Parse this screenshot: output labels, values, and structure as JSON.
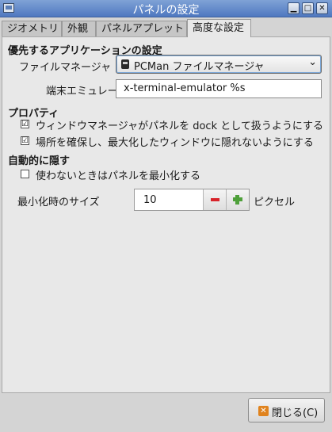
{
  "window": {
    "title": "パネルの設定",
    "controls": {
      "minimize": "▁",
      "maximize": "□",
      "close": "✕"
    }
  },
  "tabs": [
    {
      "label": "ジオメトリ"
    },
    {
      "label": "外観"
    },
    {
      "label": "パネルアプレット"
    },
    {
      "label": "高度な設定",
      "active": true
    }
  ],
  "preferred_apps": {
    "heading": "優先するアプリケーションの設定",
    "file_manager_label": "ファイルマネージャ",
    "file_manager_value": "PCMan ファイルマネージャ",
    "terminal_label": "端末エミュレータ:",
    "terminal_value": "x-terminal-emulator %s"
  },
  "properties": {
    "heading": "プロパティ",
    "dock_label": "ウィンドウマネージャがパネルを dock として扱うようにする",
    "dock_checked": true,
    "reserve_label": "場所を確保し、最大化したウィンドウに隠れないようにする",
    "reserve_checked": true
  },
  "autohide": {
    "heading": "自動的に隠す",
    "minimize_label": "使わないときはパネルを最小化する",
    "minimize_checked": false,
    "size_label": "最小化時のサイズ",
    "size_value": "10",
    "size_unit": "ピクセル"
  },
  "footer": {
    "close_label": "閉じる(C)"
  },
  "icons": {
    "check": "☑",
    "uncheck": "",
    "arrow": "⌄",
    "close_x": "✕"
  }
}
